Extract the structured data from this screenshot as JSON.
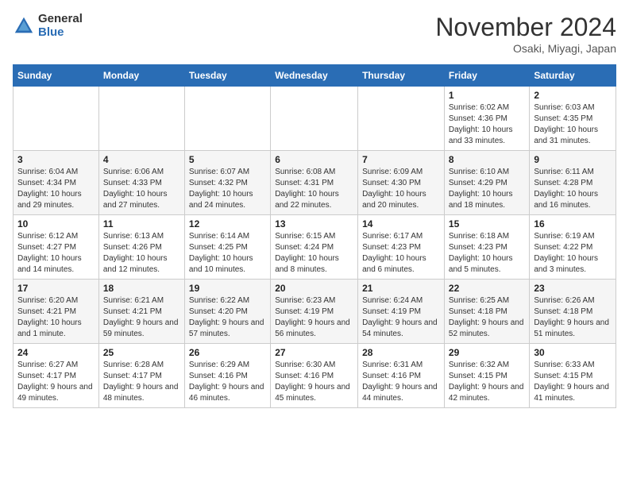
{
  "logo": {
    "general": "General",
    "blue": "Blue"
  },
  "title": "November 2024",
  "location": "Osaki, Miyagi, Japan",
  "days_of_week": [
    "Sunday",
    "Monday",
    "Tuesday",
    "Wednesday",
    "Thursday",
    "Friday",
    "Saturday"
  ],
  "weeks": [
    [
      {
        "day": "",
        "info": ""
      },
      {
        "day": "",
        "info": ""
      },
      {
        "day": "",
        "info": ""
      },
      {
        "day": "",
        "info": ""
      },
      {
        "day": "",
        "info": ""
      },
      {
        "day": "1",
        "info": "Sunrise: 6:02 AM\nSunset: 4:36 PM\nDaylight: 10 hours and 33 minutes."
      },
      {
        "day": "2",
        "info": "Sunrise: 6:03 AM\nSunset: 4:35 PM\nDaylight: 10 hours and 31 minutes."
      }
    ],
    [
      {
        "day": "3",
        "info": "Sunrise: 6:04 AM\nSunset: 4:34 PM\nDaylight: 10 hours and 29 minutes."
      },
      {
        "day": "4",
        "info": "Sunrise: 6:06 AM\nSunset: 4:33 PM\nDaylight: 10 hours and 27 minutes."
      },
      {
        "day": "5",
        "info": "Sunrise: 6:07 AM\nSunset: 4:32 PM\nDaylight: 10 hours and 24 minutes."
      },
      {
        "day": "6",
        "info": "Sunrise: 6:08 AM\nSunset: 4:31 PM\nDaylight: 10 hours and 22 minutes."
      },
      {
        "day": "7",
        "info": "Sunrise: 6:09 AM\nSunset: 4:30 PM\nDaylight: 10 hours and 20 minutes."
      },
      {
        "day": "8",
        "info": "Sunrise: 6:10 AM\nSunset: 4:29 PM\nDaylight: 10 hours and 18 minutes."
      },
      {
        "day": "9",
        "info": "Sunrise: 6:11 AM\nSunset: 4:28 PM\nDaylight: 10 hours and 16 minutes."
      }
    ],
    [
      {
        "day": "10",
        "info": "Sunrise: 6:12 AM\nSunset: 4:27 PM\nDaylight: 10 hours and 14 minutes."
      },
      {
        "day": "11",
        "info": "Sunrise: 6:13 AM\nSunset: 4:26 PM\nDaylight: 10 hours and 12 minutes."
      },
      {
        "day": "12",
        "info": "Sunrise: 6:14 AM\nSunset: 4:25 PM\nDaylight: 10 hours and 10 minutes."
      },
      {
        "day": "13",
        "info": "Sunrise: 6:15 AM\nSunset: 4:24 PM\nDaylight: 10 hours and 8 minutes."
      },
      {
        "day": "14",
        "info": "Sunrise: 6:17 AM\nSunset: 4:23 PM\nDaylight: 10 hours and 6 minutes."
      },
      {
        "day": "15",
        "info": "Sunrise: 6:18 AM\nSunset: 4:23 PM\nDaylight: 10 hours and 5 minutes."
      },
      {
        "day": "16",
        "info": "Sunrise: 6:19 AM\nSunset: 4:22 PM\nDaylight: 10 hours and 3 minutes."
      }
    ],
    [
      {
        "day": "17",
        "info": "Sunrise: 6:20 AM\nSunset: 4:21 PM\nDaylight: 10 hours and 1 minute."
      },
      {
        "day": "18",
        "info": "Sunrise: 6:21 AM\nSunset: 4:21 PM\nDaylight: 9 hours and 59 minutes."
      },
      {
        "day": "19",
        "info": "Sunrise: 6:22 AM\nSunset: 4:20 PM\nDaylight: 9 hours and 57 minutes."
      },
      {
        "day": "20",
        "info": "Sunrise: 6:23 AM\nSunset: 4:19 PM\nDaylight: 9 hours and 56 minutes."
      },
      {
        "day": "21",
        "info": "Sunrise: 6:24 AM\nSunset: 4:19 PM\nDaylight: 9 hours and 54 minutes."
      },
      {
        "day": "22",
        "info": "Sunrise: 6:25 AM\nSunset: 4:18 PM\nDaylight: 9 hours and 52 minutes."
      },
      {
        "day": "23",
        "info": "Sunrise: 6:26 AM\nSunset: 4:18 PM\nDaylight: 9 hours and 51 minutes."
      }
    ],
    [
      {
        "day": "24",
        "info": "Sunrise: 6:27 AM\nSunset: 4:17 PM\nDaylight: 9 hours and 49 minutes."
      },
      {
        "day": "25",
        "info": "Sunrise: 6:28 AM\nSunset: 4:17 PM\nDaylight: 9 hours and 48 minutes."
      },
      {
        "day": "26",
        "info": "Sunrise: 6:29 AM\nSunset: 4:16 PM\nDaylight: 9 hours and 46 minutes."
      },
      {
        "day": "27",
        "info": "Sunrise: 6:30 AM\nSunset: 4:16 PM\nDaylight: 9 hours and 45 minutes."
      },
      {
        "day": "28",
        "info": "Sunrise: 6:31 AM\nSunset: 4:16 PM\nDaylight: 9 hours and 44 minutes."
      },
      {
        "day": "29",
        "info": "Sunrise: 6:32 AM\nSunset: 4:15 PM\nDaylight: 9 hours and 42 minutes."
      },
      {
        "day": "30",
        "info": "Sunrise: 6:33 AM\nSunset: 4:15 PM\nDaylight: 9 hours and 41 minutes."
      }
    ]
  ]
}
